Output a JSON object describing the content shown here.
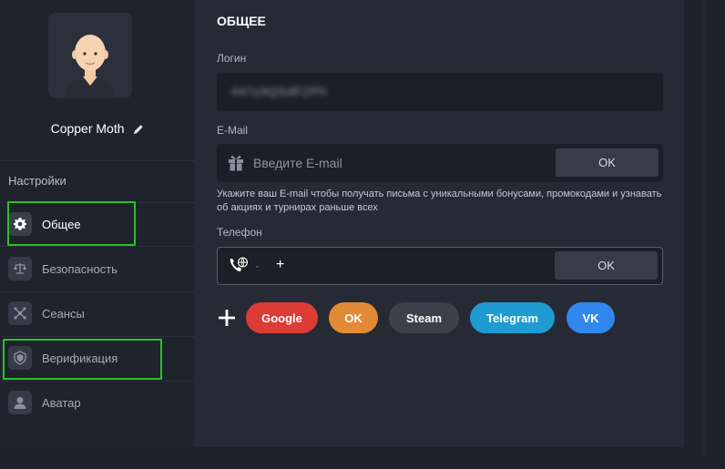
{
  "user": {
    "name": "Copper Moth"
  },
  "sidebar": {
    "section_title": "Настройки",
    "items": [
      {
        "label": "Общее",
        "icon": "gear-icon"
      },
      {
        "label": "Безопасность",
        "icon": "scales-icon"
      },
      {
        "label": "Сеансы",
        "icon": "network-icon"
      },
      {
        "label": "Верификация",
        "icon": "shield-icon"
      },
      {
        "label": "Аватар",
        "icon": "user-icon"
      }
    ]
  },
  "general": {
    "title": "ОБЩЕЕ",
    "login_label": "Логин",
    "login_value": "447z4QSdFZPh",
    "email_label": "E-Mail",
    "email_placeholder": "Введите E-mail",
    "email_ok": "OK",
    "email_hint": "Укажите ваш E-mail чтобы получать письма с уникальными бонусами, промокодами и узнавать об акциях и турнирах раньше всех",
    "phone_label": "Телефон",
    "phone_prefix": "+",
    "phone_ok": "OK"
  },
  "socials": [
    {
      "label": "Google",
      "color": "#dd3b36"
    },
    {
      "label": "OK",
      "color": "#e38a37"
    },
    {
      "label": "Steam",
      "color": "#3e4049"
    },
    {
      "label": "Telegram",
      "color": "#1e9bd1"
    },
    {
      "label": "VK",
      "color": "#3187ee"
    }
  ],
  "colors": {
    "highlight": "#27c22a",
    "panel": "#262a34",
    "sidebar": "#1f232c"
  }
}
